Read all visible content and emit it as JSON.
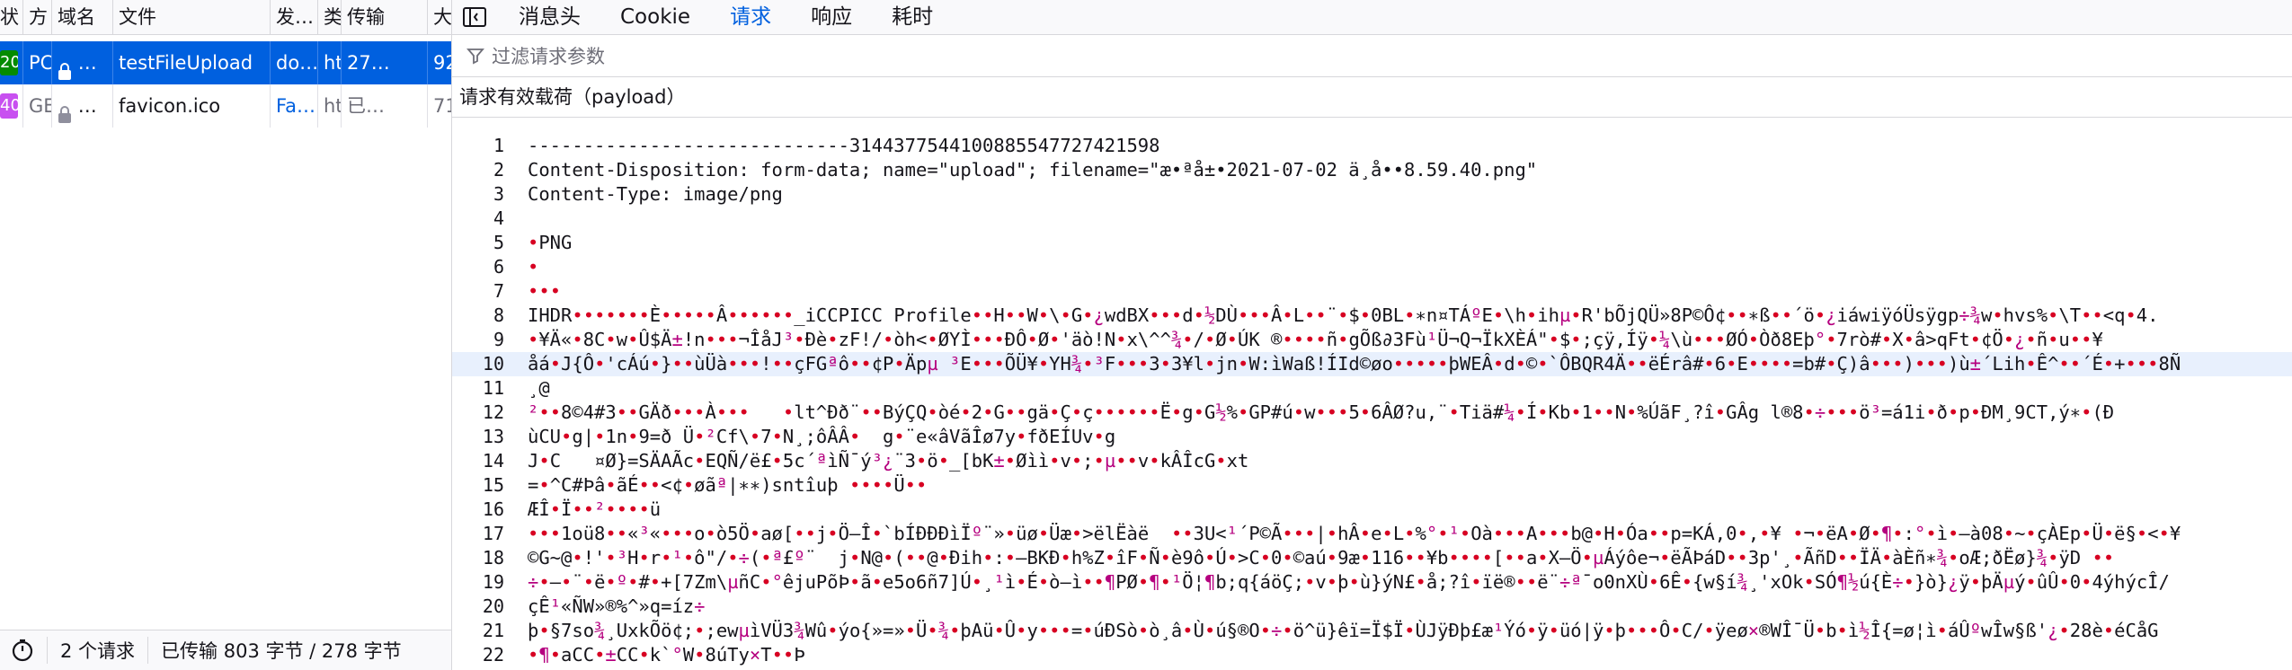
{
  "list": {
    "headers": [
      "状",
      "方",
      "域名",
      "文件",
      "发…",
      "类",
      "传输",
      "大"
    ],
    "rows": [
      {
        "status": "20",
        "method": "PC",
        "domain": "…",
        "file": "testFileUpload",
        "initiator": "do…",
        "type": "ht",
        "transferred": "27…",
        "size": "92",
        "status_color": "#058b00"
      },
      {
        "status": "40",
        "method": "GE",
        "domain": "…",
        "file": "favicon.ico",
        "initiator": "Fa…",
        "type": "ht",
        "transferred": "已…",
        "size": "71",
        "status_color": "#c850f0"
      }
    ]
  },
  "footer": {
    "requests": "2 个请求",
    "transferred": "已传输 803 字节 / 278 字节"
  },
  "details": {
    "tabs": [
      "消息头",
      "Cookie",
      "请求",
      "响应",
      "耗时"
    ],
    "active_tab": "请求",
    "filter_placeholder": "过滤请求参数",
    "payload_title": "请求有效载荷（payload）"
  },
  "payload_lines": [
    {
      "n": "1",
      "t": "-----------------------------3144377544100885547727421598"
    },
    {
      "n": "2",
      "t": "Content-Disposition: form-data; name=\"upload\"; filename=\"æ•ªå±•2021-07-02 ä¸å••8.59.40.png\""
    },
    {
      "n": "3",
      "t": "Content-Type: image/png"
    },
    {
      "n": "4",
      "t": ""
    },
    {
      "n": "5",
      "t": "•PNG"
    },
    {
      "n": "6",
      "t": "•"
    },
    {
      "n": "7",
      "t": "•••"
    },
    {
      "n": "8",
      "t": "IHDR•••••••È•••••Â••••••_iCCPICC Profile••H••W•\\•G•¿wdBX•••d•½DÙ•••Â•L••¨•$•0BL•∗n¤TÁºE•\\h•ihµ•R'bÕjQÜ»8P©Ô¢••∗ß••´ö•¿iáwiÿóÜsÿgp÷¾w•hvs%•\\T••<q•4."
    },
    {
      "n": "9",
      "t": "•¥Ä«•8C•w•Û$Ä±!n•••¬ÎåJ³•Ðè•zF!/•òh<•ØYÌ•••ÐÔ•Ø•'äò!N•x\\^^¾•/•Ø•ÚK ®••••ñ•gÕß∂3Fù¹Ü¬Q¬ÏkXÈÁ\"•$•;çÿ,Íÿ•¼\\ù•••ØÓ•Òð8Eþ°•7rò#•X•â>qFt•¢Ö•¿•ñ•u••¥"
    },
    {
      "n": "10",
      "t": "åá•J{Ô•'cÁú•}••ùÜà•••!••çFGªô••¢P•Äpµ ³E•••ÕÜ¥•YH¾•³F•••3•3¥l•jn•W:ìWaß!ÍId©øo•••••þWEÂ•d•©•`ÔBQR4Ä••ëÉrâ#•6•E••••=b#•Ç)â•••)•••)ù±´Lih•Ê^••´É•+•••8Ñ"
    },
    {
      "n": "11",
      "t": "¸@"
    },
    {
      "n": "12",
      "t": "²••8©4#3••GÄð•••À•••   •lt^Ðð¨••BýÇQ•òé•2•G••gä•Ç•ç••••••Ë•g•G½%•GP#ú•w•••5•6ÂØ?u,¨•Tiä#¼•Í•Kb•1••N•%ÚãF¸?î•GÂg l®8•÷•••ö³=á1i•ð•p•ÐM¸9CT,ý∗•(Ð"
    },
    {
      "n": "13",
      "t": "ùCU•g|•1n•9=ð Ü•²Cf\\•7•N¸;ôÂÂ•  g•¨e«âVãÎø7y•fðEÍUv•g"
    },
    {
      "n": "14",
      "t": "J•C   ¤Ø}=SÄAÃc•EQÑ/ë£•5c´ªìÑ¯ý³¿¨3•ö•_[bK±•Øìì•v•;•µ••v•kÂÎcG•xt"
    },
    {
      "n": "15",
      "t": "=•^C#Þâ•ãÉ••<¢•øãª|∗∗)sntîuþ ••••Ü••"
    },
    {
      "n": "16",
      "t": "ÆÎ•Ï••²••••ü"
    },
    {
      "n": "17",
      "t": "•••1oü8••«³«•••o•ò5Ö•aø[••j•Ö–Î•`bÍÐÐÐìÏº¨»•üø•Üæ•>ëlËàë  ••3U<¹´P©Ã•••|•hÂ•e•L•%°•¹•Oà•••A•••b@•H•Óa••p=KÁ,0•,•¥ •¬•ëA•Ø•¶•:°•ì•–à08•~•çÀEp•Ü•ë§•<•¥"
    },
    {
      "n": "18",
      "t": "©G~@•!'•³H•r•¹•ô\"/•÷(•ª£º¨  j•N@•(••@•Ðih•:•–BKÐ•h%Z•îF•Ñ•è9ô•Ú•>C•0•©aú•9æ•116••¥b••••[••a•X–Ö•µÁýôe¬•ëÃÞáD••3p'¸•ÃñD••ÏÄ•àÈñ∗¾•oÆ;ðËø}¾•ÿD •• "
    },
    {
      "n": "19",
      "t": "÷•–•¨•ë•º•#•+[7Zm\\µñC•°êjuPõÞ•ã•e5o6ñ7]Ú•¸¹ì•É•ò–ì••¶PØ•¶•¹Ö¦¶b;q{áöÇ;•v•þ•ù}ýN£•å;?î•ïë®••ë¨÷ª¯o0nXÙ•6Ê•{w§í¾¸'xOk•SÓ¶½ú{È÷•}ò}¿ÿ•þÄµý•ûÛ•0•4ýhýcÎ/"
    },
    {
      "n": "20",
      "t": "çÊ¹«ÑW»®%^»q=íz÷"
    },
    {
      "n": "21",
      "t": "þ•§7so¾¸UxkÕö¢;•;ewµìVÜ3¾Wû•ýo{»=»•Ü•¾•þAü•Û•y•••=•úÐSò•ò¸â•Ù•ú§®O•÷•ö^ü}êï=Ï$Ï•ÙJÿÐþ£æ¹Ýó•ÿ•üó|ÿ•þ•••Ô•C/•ÿeø×®WÎ¯Ü•b•ì½Î{=ø¦ì•áÛºwÎw§ß'¿•28è•éCåG"
    },
    {
      "n": "22",
      "t": "•¶•aCC•±CC•k`°W•8úTy×T••Þ"
    }
  ]
}
